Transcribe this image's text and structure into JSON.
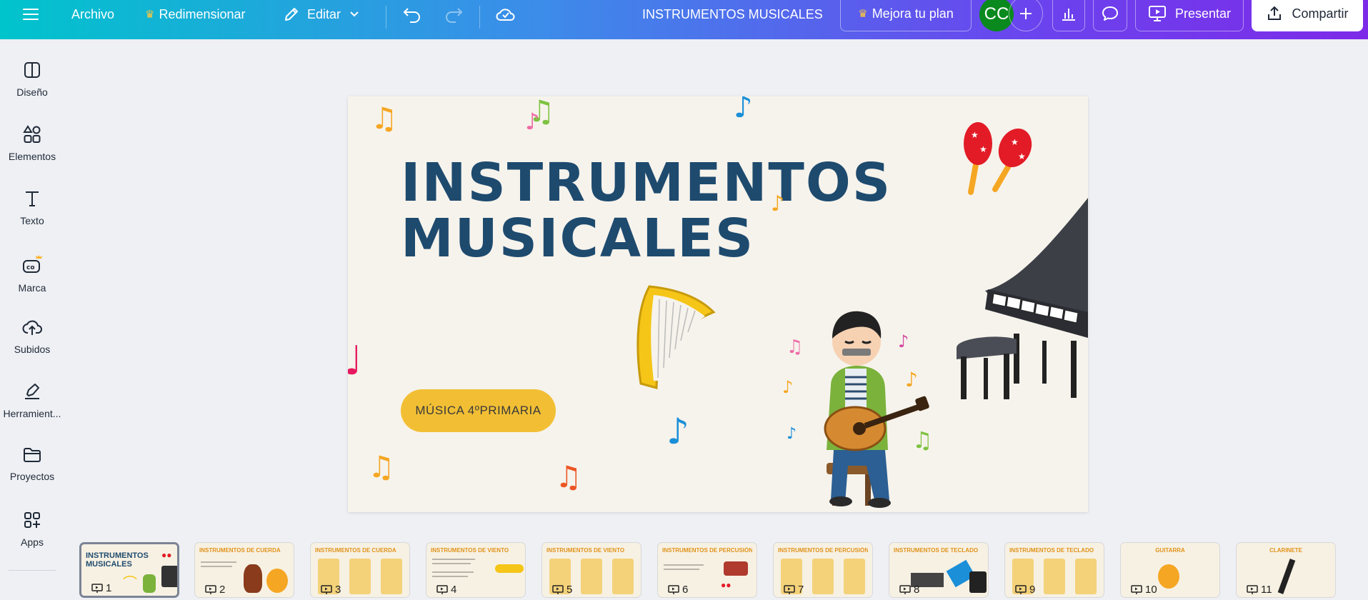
{
  "topbar": {
    "menu_icon": "hamburger-icon",
    "file_label": "Archivo",
    "resize_label": "Redimensionar",
    "edit_label": "Editar",
    "doc_title": "INSTRUMENTOS MUSICALES",
    "upgrade_label": "Mejora tu plan",
    "avatar_initials": "CC",
    "present_label": "Presentar",
    "share_label": "Compartir"
  },
  "sidebar": {
    "items": [
      {
        "label": "Diseño",
        "icon": "layout-icon"
      },
      {
        "label": "Elementos",
        "icon": "shapes-icon"
      },
      {
        "label": "Texto",
        "icon": "text-icon"
      },
      {
        "label": "Marca",
        "icon": "brand-icon"
      },
      {
        "label": "Subidos",
        "icon": "cloud-upload-icon"
      },
      {
        "label": "Herramient...",
        "icon": "pen-tool-icon"
      },
      {
        "label": "Proyectos",
        "icon": "folder-icon"
      },
      {
        "label": "Apps",
        "icon": "apps-icon"
      }
    ]
  },
  "slide": {
    "title_line1": "INSTRUMENTOS",
    "title_line2": "MUSICALES",
    "subtitle": "MÚSICA 4ºPRIMARIA"
  },
  "thumbnails": [
    {
      "num": "1",
      "title": "INSTRUMENTOS MUSICALES"
    },
    {
      "num": "2",
      "title": "INSTRUMENTOS DE CUERDA"
    },
    {
      "num": "3",
      "title": "INSTRUMENTOS DE CUERDA"
    },
    {
      "num": "4",
      "title": "INSTRUMENTOS DE VIENTO"
    },
    {
      "num": "5",
      "title": "INSTRUMENTOS DE VIENTO"
    },
    {
      "num": "6",
      "title": "INSTRUMENTOS DE PERCUSIÓN"
    },
    {
      "num": "7",
      "title": "INSTRUMENTOS DE PERCUSIÓN"
    },
    {
      "num": "8",
      "title": "INSTRUMENTOS DE TECLADO"
    },
    {
      "num": "9",
      "title": "INSTRUMENTOS DE TECLADO"
    },
    {
      "num": "10",
      "title": "GUITARRA"
    },
    {
      "num": "11",
      "title": "CLARINETE"
    }
  ],
  "colors": {
    "title_navy": "#1e4a6e",
    "pill_yellow": "#f2bf34",
    "avatar_green": "#0a8a1e",
    "crown_gold": "#ffc83d"
  }
}
